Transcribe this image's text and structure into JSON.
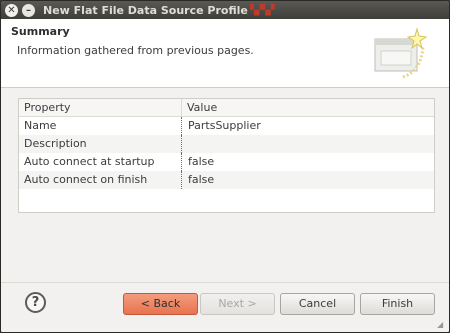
{
  "window": {
    "title": "New Flat File Data Source Profile",
    "close_glyph": "✕",
    "min_glyph": "–"
  },
  "header": {
    "title": "Summary",
    "description": "Information gathered from previous pages."
  },
  "table": {
    "columns": [
      "Property",
      "Value"
    ],
    "rows": [
      {
        "property": "Name",
        "value": "PartsSupplier"
      },
      {
        "property": "Description",
        "value": ""
      },
      {
        "property": "Auto connect at startup",
        "value": "false"
      },
      {
        "property": "Auto connect on finish",
        "value": "false"
      }
    ]
  },
  "buttons": {
    "help": "?",
    "back": "< Back",
    "next": "Next >",
    "cancel": "Cancel",
    "finish": "Finish"
  },
  "icons": {
    "help": "help-icon",
    "header_image": "wizard-banner-icon"
  },
  "colors": {
    "accent": "#ef7f5a",
    "titlebar": "#3f3e3a"
  }
}
